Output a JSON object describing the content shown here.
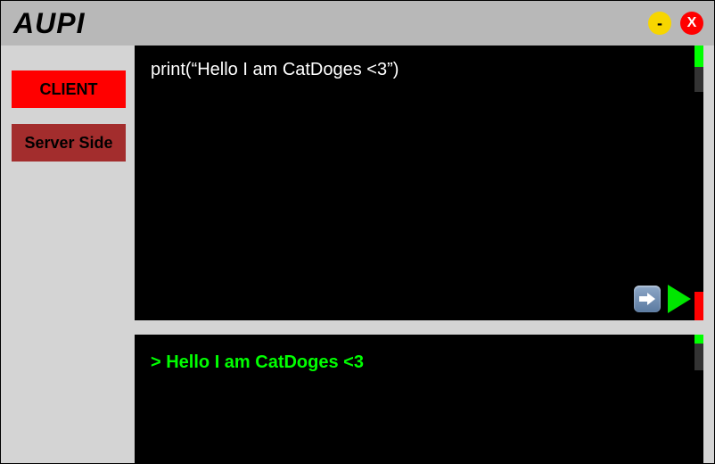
{
  "titlebar": {
    "app_name": "AUPI",
    "minimize_glyph": "-",
    "close_glyph": "X"
  },
  "sidebar": {
    "items": [
      {
        "label": "CLIENT",
        "active": true
      },
      {
        "label": "Server Side",
        "active": false
      }
    ]
  },
  "editor": {
    "code": "print(“Hello I am CatDoges <3”)"
  },
  "output": {
    "text": "> Hello I am CatDoges <3"
  },
  "colors": {
    "accent_green": "#00ff00",
    "accent_red": "#ff0000",
    "sidebar_active": "#ff0000",
    "sidebar_inactive": "#a32d2d"
  }
}
